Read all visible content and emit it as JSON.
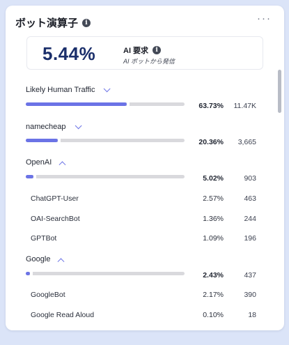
{
  "card": {
    "title": "ボット演算子",
    "info_icon": "i",
    "more_icon": "···"
  },
  "metric": {
    "value": "5.44%",
    "label": "AI 要求",
    "sub": "AI ボットから発信",
    "info_icon": "i"
  },
  "groups": [
    {
      "label": "Likely Human Traffic",
      "expanded": false,
      "share": 63.73,
      "percent": "63.73%",
      "count": "11.47K"
    },
    {
      "label": "namecheap",
      "expanded": false,
      "share": 20.36,
      "percent": "20.36%",
      "count": "3,665"
    },
    {
      "label": "OpenAI",
      "expanded": true,
      "share": 5.02,
      "percent": "5.02%",
      "count": "903",
      "children": [
        {
          "label": "ChatGPT-User",
          "percent": "2.57%",
          "count": "463"
        },
        {
          "label": "OAI-SearchBot",
          "percent": "1.36%",
          "count": "244"
        },
        {
          "label": "GPTBot",
          "percent": "1.09%",
          "count": "196"
        }
      ]
    },
    {
      "label": "Google",
      "expanded": true,
      "share": 2.43,
      "percent": "2.43%",
      "count": "437",
      "children": [
        {
          "label": "GoogleBot",
          "percent": "2.17%",
          "count": "390"
        },
        {
          "label": "Google Read Aloud",
          "percent": "0.10%",
          "count": "18"
        }
      ]
    }
  ],
  "colors": {
    "accent": "#6b73e6",
    "track": "#d9d9dd",
    "metric_value": "#1b2f6b",
    "background": "#dbe4f8"
  }
}
